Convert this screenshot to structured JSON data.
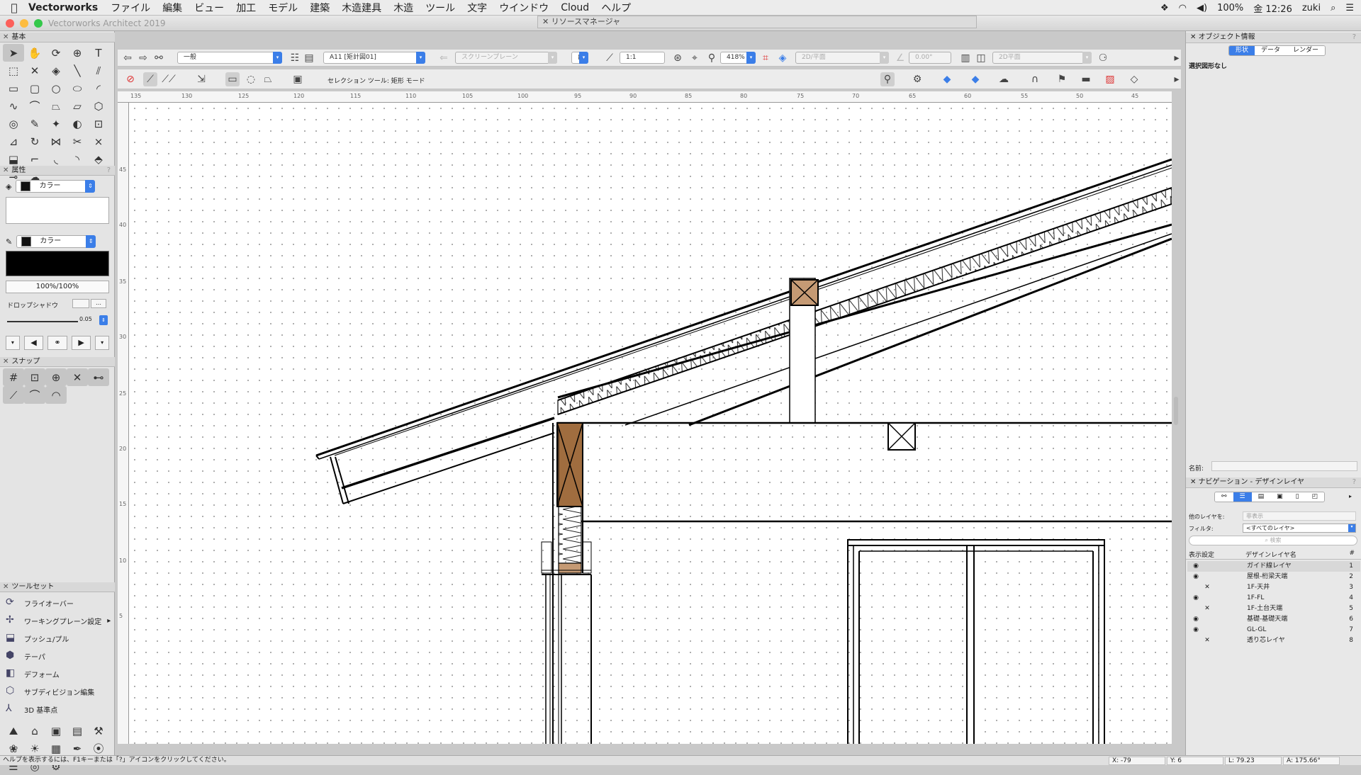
{
  "menubar": {
    "app_name": "Vectorworks",
    "items": [
      "ファイル",
      "編集",
      "ビュー",
      "加工",
      "モデル",
      "建築",
      "木造建具",
      "木造",
      "ツール",
      "文字",
      "ウインドウ",
      "Cloud",
      "ヘルプ"
    ],
    "battery": "100%",
    "clock": "金 12:26",
    "user": "zuki"
  },
  "window": {
    "title": "Vectorworks Architect 2019",
    "resource_manager": "リソースマネージャ"
  },
  "left": {
    "basic_title": "基本",
    "attributes_title": "属性",
    "fill_label": "カラー",
    "pen_label": "カラー",
    "opacity": "100%/100%",
    "drop_shadow_label": "ドロップシャドウ",
    "line_weight": "0.05",
    "snap_title": "スナップ",
    "toolset_title": "ツールセット",
    "toolset_items": [
      "フライオーバー",
      "ワーキングプレーン設定",
      "プッシュ/プル",
      "テーパ",
      "デフォーム",
      "サブディビジョン編集",
      "3D 基準点"
    ]
  },
  "toolbar1": {
    "class_value": "一般",
    "layer_value": "A11 [矩計図01]",
    "plane_value": "スクリーンプレーン",
    "scale_value": "1:1",
    "zoom_value": "418%",
    "view_value": "2D/平面",
    "angle_value": "0.00°",
    "render_value": "2D平面"
  },
  "toolbar2": {
    "mode_text": "セレクション ツール: 矩形 モード"
  },
  "ruler": {
    "top_ticks": [
      "135",
      "130",
      "125",
      "120",
      "115",
      "110",
      "105",
      "100",
      "95",
      "90",
      "85",
      "80",
      "75",
      "70",
      "65",
      "60",
      "55",
      "50",
      "45"
    ],
    "left_ticks": [
      "45",
      "40",
      "35",
      "30",
      "25",
      "20",
      "15",
      "10",
      "5"
    ]
  },
  "right": {
    "oi_title": "オブジェクト情報",
    "tabs": [
      "形状",
      "データ",
      "レンダー"
    ],
    "selection_text": "選択図形なし",
    "name_label": "名前:",
    "nav_title": "ナビゲーション - デザインレイヤ",
    "other_layers_label": "他のレイヤを:",
    "other_layers_value": "非表示",
    "filter_label": "フィルタ:",
    "filter_value": "<すべてのレイヤ>",
    "search_placeholder": "検索",
    "col_visibility": "表示設定",
    "col_name": "デザインレイヤ名",
    "col_num": "#",
    "layers": [
      {
        "vis": "◉",
        "name": "ガイド線レイヤ",
        "num": "1"
      },
      {
        "vis": "◉",
        "name": "屋根-桁梁天端",
        "num": "2"
      },
      {
        "vis": "✕",
        "name": "1F-天井",
        "num": "3"
      },
      {
        "vis": "◉",
        "name": "1F-FL",
        "num": "4"
      },
      {
        "vis": "✕",
        "name": "1F-土台天端",
        "num": "5"
      },
      {
        "vis": "◉",
        "name": "基礎-基礎天端",
        "num": "6"
      },
      {
        "vis": "◉",
        "name": "GL-GL",
        "num": "7"
      },
      {
        "vis": "✕",
        "name": "透り芯レイヤ",
        "num": "8"
      }
    ]
  },
  "status": {
    "help": "ヘルプを表示するには、F1キーまたは「?」アイコンをクリックしてください。",
    "x": "X: -79",
    "y": "Y: 6",
    "l": "L: 79.23",
    "a": "A: 175.66°"
  }
}
